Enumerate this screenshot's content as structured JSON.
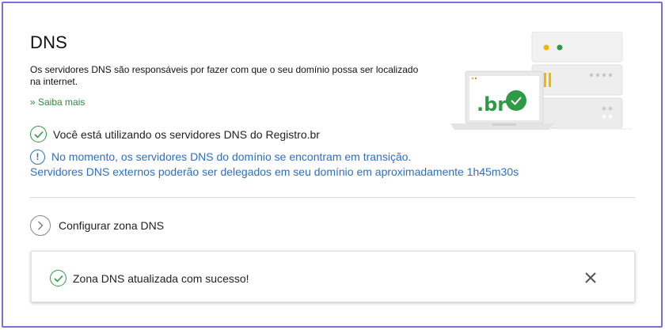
{
  "page": {
    "title": "DNS",
    "description": "Os servidores DNS são responsáveis por fazer com que o seu domínio possa ser localizado na internet.",
    "learn_more": "» Saiba mais"
  },
  "status": {
    "text": "Você está utilizando os servidores DNS do Registro.br"
  },
  "info": {
    "line1": "No momento, os servidores DNS do domínio se encontram em transição.",
    "line2": "Servidores DNS externos poderão ser delegados em seu domínio em aproximadamente 1h45m30s"
  },
  "config": {
    "label": "Configurar zona DNS"
  },
  "toast": {
    "message": "Zona DNS atualizada com sucesso!"
  },
  "illustration": {
    "laptop_text": ".br"
  },
  "colors": {
    "accent_green": "#2f9a45",
    "info_blue": "#2c6fc6",
    "frame_border": "#7b6fd6"
  }
}
